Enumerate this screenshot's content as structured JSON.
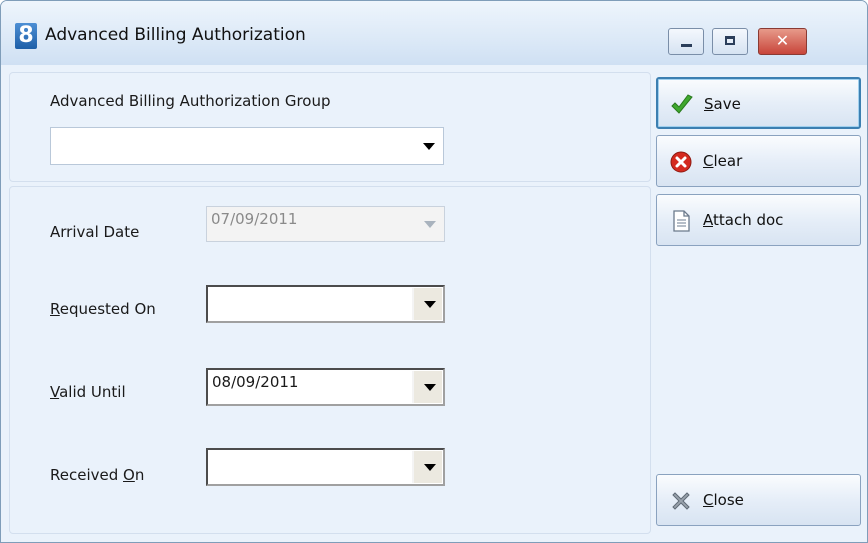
{
  "window": {
    "title": "Advanced Billing Authorization",
    "app_icon_text": "8"
  },
  "group": {
    "label": "Advanced Billing Authorization Group",
    "value": ""
  },
  "fields": {
    "arrival_date": {
      "label": "Arrival Date",
      "value": "07/09/2011",
      "enabled": false
    },
    "requested_on": {
      "label_u": "R",
      "label_rest": "equested On",
      "value": ""
    },
    "valid_until": {
      "label_u": "V",
      "label_rest": "alid Until",
      "value": "08/09/2011"
    },
    "received_on": {
      "label_pre": "Received ",
      "label_u": "O",
      "label_rest": "n",
      "value": ""
    }
  },
  "buttons": {
    "save": {
      "u": "S",
      "rest": "ave",
      "icon": "checkmark-icon",
      "color": "#3fa82e"
    },
    "clear": {
      "u": "",
      "pre": "C",
      "rest": "lear",
      "icon": "clear-x-icon",
      "color": "#d42a1f"
    },
    "attach": {
      "u": "A",
      "rest": "ttach doc",
      "icon": "document-icon"
    },
    "close": {
      "u": "C",
      "rest": "lose",
      "icon": "close-x-icon"
    }
  }
}
